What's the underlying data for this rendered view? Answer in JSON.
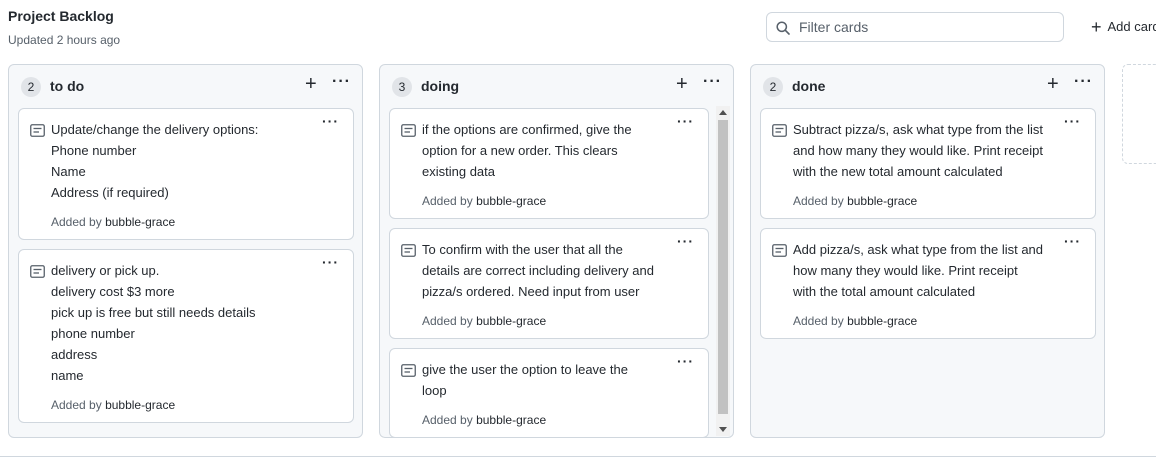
{
  "header": {
    "title": "Project Backlog",
    "updated": "Updated 2 hours ago",
    "filter_placeholder": "Filter cards",
    "add_card_label": "Add card",
    "add_icon": "plus-icon",
    "search_icon": "search-icon"
  },
  "columns": [
    {
      "count": "2",
      "title": "to do",
      "cards": [
        {
          "text": "Update/change the delivery options:\nPhone number\nName\nAddress (if required)",
          "added_prefix": "Added by",
          "author": "bubble-grace"
        },
        {
          "text": "delivery or pick up.\ndelivery cost $3 more\npick up is free but still needs details\nphone number\naddress\nname",
          "added_prefix": "Added by",
          "author": "bubble-grace"
        }
      ]
    },
    {
      "count": "3",
      "title": "doing",
      "cards": [
        {
          "text": "if the options are confirmed, give the\noption for a new order. This clears\nexisting data",
          "added_prefix": "Added by",
          "author": "bubble-grace"
        },
        {
          "text": "To confirm with the user that all the\ndetails are correct including delivery and\npizza/s ordered. Need input from user",
          "added_prefix": "Added by",
          "author": "bubble-grace"
        },
        {
          "text": "give the user the option to leave the\nloop",
          "added_prefix": "Added by",
          "author": "bubble-grace"
        }
      ]
    },
    {
      "count": "2",
      "title": "done",
      "cards": [
        {
          "text": "Subtract pizza/s, ask what type from the list\nand how many they would like. Print receipt\nwith the new total amount calculated",
          "added_prefix": "Added by",
          "author": "bubble-grace"
        },
        {
          "text": "Add pizza/s, ask what type from the list and\nhow many they would like. Print receipt\nwith the total amount calculated",
          "added_prefix": "Added by",
          "author": "bubble-grace"
        }
      ]
    }
  ]
}
